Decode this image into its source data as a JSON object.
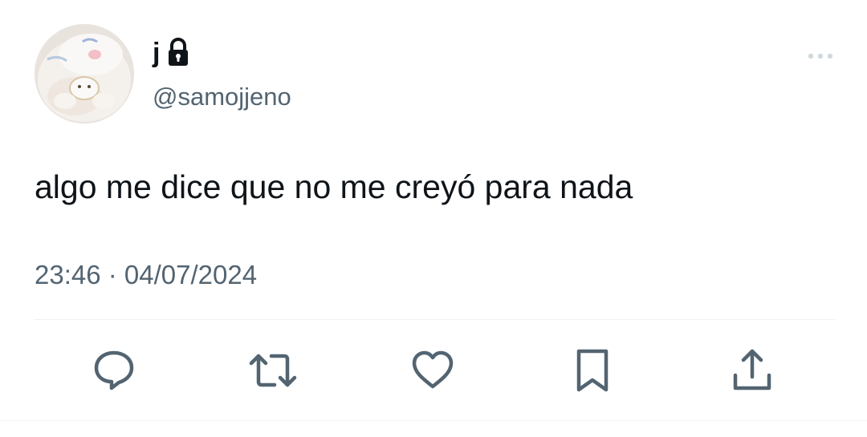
{
  "user": {
    "display_name": "j",
    "handle": "@samojjeno",
    "avatar_icon": "avatar-image",
    "protected_icon": "lock-icon"
  },
  "tweet": {
    "text": "algo me dice que no me creyó para nada",
    "timestamp": "23:46 · 04/07/2024"
  },
  "menu": {
    "icon": "more-options-icon"
  },
  "actions": [
    {
      "name": "reply",
      "icon": "reply-icon"
    },
    {
      "name": "retweet",
      "icon": "retweet-icon"
    },
    {
      "name": "like",
      "icon": "heart-icon"
    },
    {
      "name": "bookmark",
      "icon": "bookmark-icon"
    },
    {
      "name": "share",
      "icon": "share-icon"
    }
  ],
  "colors": {
    "primary_text": "#0f1419",
    "secondary_text": "#536471",
    "divider": "#eff3f4",
    "icon": "#536471",
    "more_icon": "#cfd9de"
  }
}
